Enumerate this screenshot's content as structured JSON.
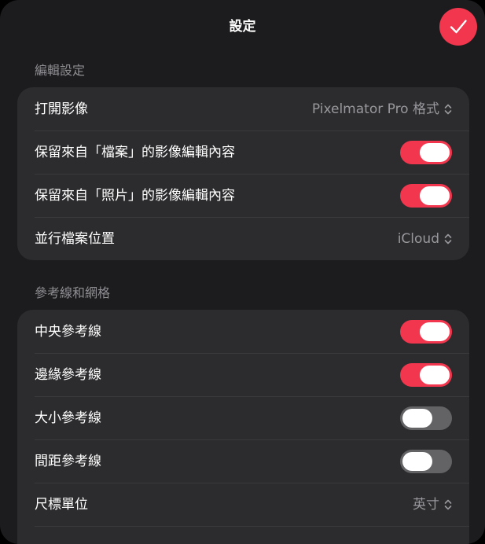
{
  "header": {
    "title": "設定",
    "done_icon": "checkmark-icon"
  },
  "sections": [
    {
      "header": "編輯設定",
      "rows": [
        {
          "label": "打開影像",
          "type": "select",
          "value": "Pixelmator Pro 格式"
        },
        {
          "label": "保留來自「檔案」的影像編輯內容",
          "type": "toggle",
          "on": true
        },
        {
          "label": "保留來自「照片」的影像編輯內容",
          "type": "toggle",
          "on": true
        },
        {
          "label": "並行檔案位置",
          "type": "select",
          "value": "iCloud"
        }
      ]
    },
    {
      "header": "參考線和網格",
      "rows": [
        {
          "label": "中央參考線",
          "type": "toggle",
          "on": true
        },
        {
          "label": "邊緣參考線",
          "type": "toggle",
          "on": true
        },
        {
          "label": "大小參考線",
          "type": "toggle",
          "on": false
        },
        {
          "label": "間距參考線",
          "type": "toggle",
          "on": false
        },
        {
          "label": "尺標單位",
          "type": "select",
          "value": "英寸"
        }
      ]
    }
  ],
  "colors": {
    "accent": "#f2364d",
    "background": "#1c1c1e",
    "group_background": "#2c2c2e",
    "toggle_off": "#636366",
    "secondary_text": "#98989d"
  }
}
